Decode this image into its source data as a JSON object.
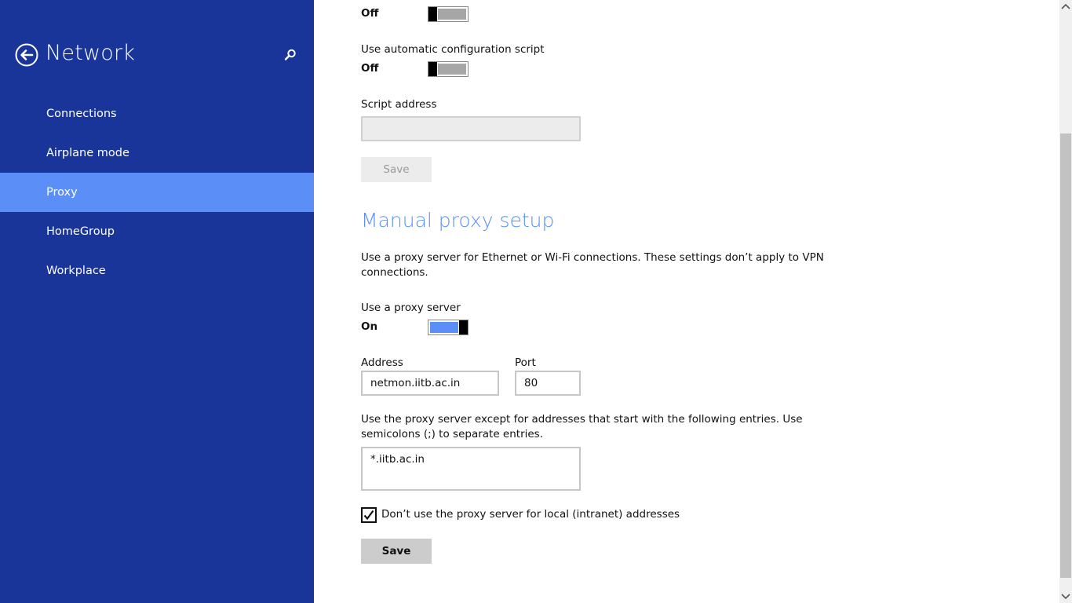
{
  "sidebar": {
    "title": "Network",
    "items": [
      {
        "label": "Connections"
      },
      {
        "label": "Airplane mode"
      },
      {
        "label": "Proxy"
      },
      {
        "label": "HomeGroup"
      },
      {
        "label": "Workplace"
      }
    ],
    "selected": "Proxy"
  },
  "auto": {
    "detect_state": "Off",
    "script_label": "Use automatic configuration script",
    "script_state": "Off",
    "address_label": "Script address",
    "address_value": "",
    "save_label": "Save"
  },
  "manual": {
    "title": "Manual proxy setup",
    "description": "Use a proxy server for Ethernet or Wi-Fi connections. These settings don’t apply to VPN connections.",
    "use_label": "Use a proxy server",
    "use_state": "On",
    "address_label": "Address",
    "address_value": "netmon.iitb.ac.in",
    "port_label": "Port",
    "port_value": "80",
    "exceptions_description": "Use the proxy server except for addresses that start with the following entries. Use semicolons (;) to separate entries.",
    "exceptions_value": "*.iitb.ac.in",
    "local_label": "Don’t use the proxy server for local (intranet) addresses",
    "local_checked": true,
    "save_label": "Save"
  },
  "colors": {
    "sidebar_bg": "#1a3599",
    "accent": "#5b8ff7"
  },
  "icons": {
    "back": "back-arrow-circle-icon",
    "search": "search-icon",
    "check": "checkmark-icon"
  }
}
